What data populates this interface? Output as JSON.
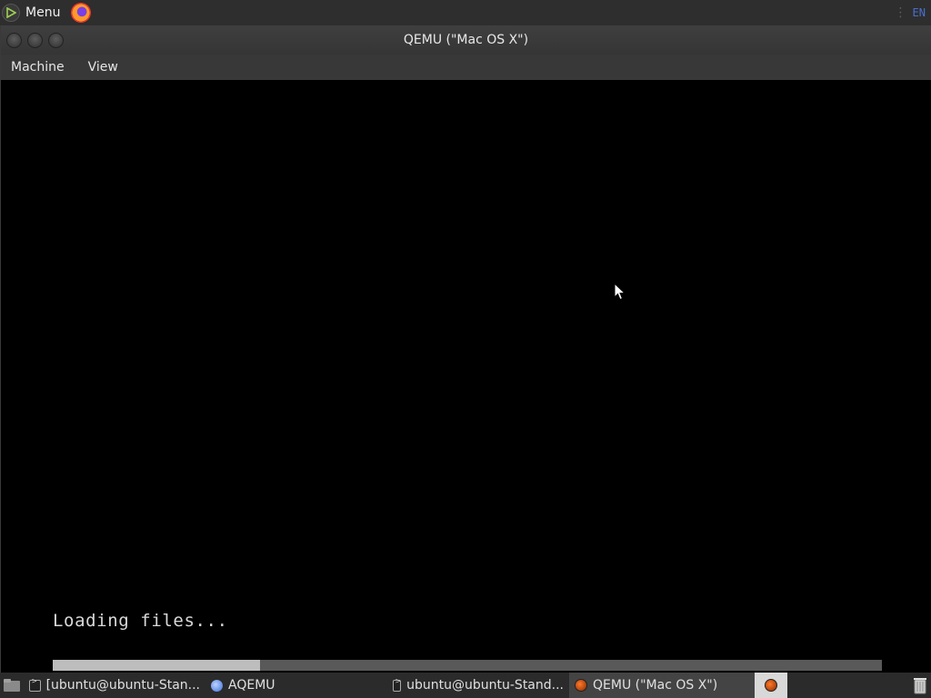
{
  "top_panel": {
    "menu_label": "Menu",
    "menu_icon": "mint-menu-icon",
    "launcher_icon": "firefox-icon",
    "lang_indicator": "EN",
    "colors": {
      "panel_bg": "#2e2e2e",
      "lang": "#4a6ed0"
    }
  },
  "window": {
    "title": "QEMU (\"Mac OS X\")",
    "menus": [
      "Machine",
      "View"
    ]
  },
  "guest_screen": {
    "status_text": "Loading files...",
    "progress_fraction": 0.25
  },
  "taskbar": {
    "tasks": [
      {
        "label": "[ubuntu@ubuntu-Stan...",
        "icon": "terminal-icon"
      },
      {
        "label": "AQEMU",
        "icon": "aqemu-icon"
      },
      {
        "label": "ubuntu@ubuntu-Stand...",
        "icon": "terminal-icon"
      },
      {
        "label": "QEMU (\"Mac OS X\")",
        "icon": "qemu-icon",
        "active": true
      }
    ]
  }
}
